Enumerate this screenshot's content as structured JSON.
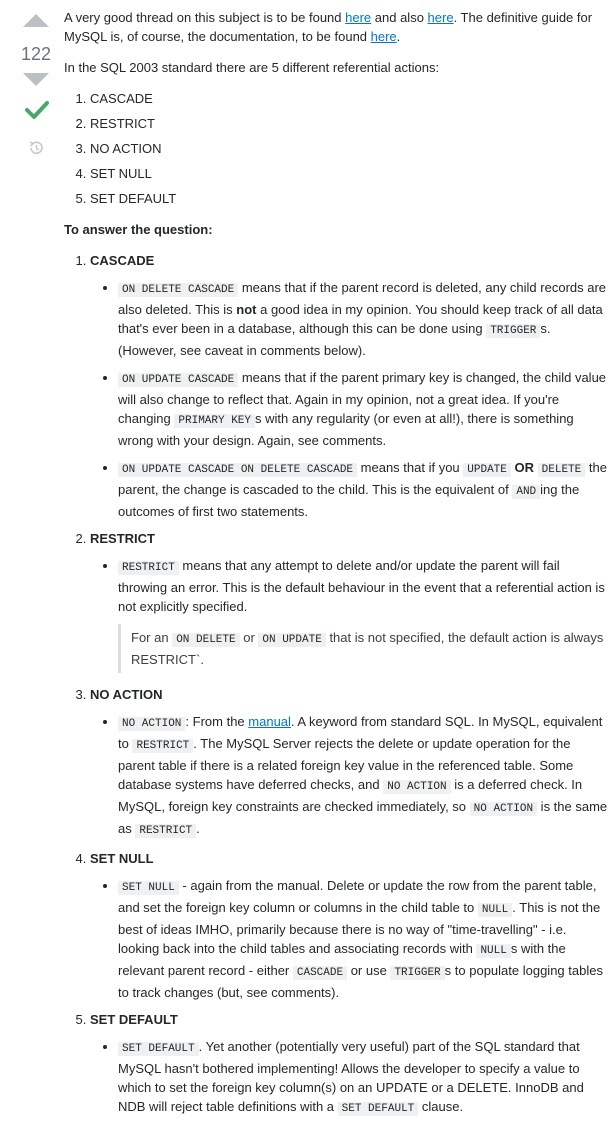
{
  "vote": {
    "count": "122"
  },
  "intro": {
    "part1": "A very good thread on this subject is to be found ",
    "link1": "here",
    "part2": " and also ",
    "link2": "here",
    "part3": ". The definitive guide for MySQL is, of course, the documentation, to be found ",
    "link3": "here",
    "part4": "."
  },
  "standard_text": "In the SQL 2003 standard there are 5 different referential actions:",
  "actions": [
    "CASCADE",
    "RESTRICT",
    "NO ACTION",
    "SET NULL",
    "SET DEFAULT"
  ],
  "answer_heading": "To answer the question:",
  "sections": {
    "cascade": {
      "title": "CASCADE",
      "b1": {
        "code1": "ON DELETE CASCADE",
        "t1": " means that if the parent record is deleted, any child records are also deleted. This is ",
        "bold": "not",
        "t2": " a good idea in my opinion. You should keep track of all data that's ever been in a database, although this can be done using ",
        "code2": "TRIGGER",
        "t3": "s. (However, see caveat in comments below)."
      },
      "b2": {
        "code1": "ON UPDATE CASCADE",
        "t1": " means that if the parent primary key is changed, the child value will also change to reflect that. Again in my opinion, not a great idea. If you're changing ",
        "code2": "PRIMARY KEY",
        "t2": "s with any regularity (or even at all!), there is something wrong with your design. Again, see comments."
      },
      "b3": {
        "code1": "ON UPDATE CASCADE ON DELETE CASCADE",
        "t1": " means that if you ",
        "code2": "UPDATE",
        "bold": "OR",
        "code3": "DELETE",
        "t2": " the parent, the change is cascaded to the child. This is the equivalent of ",
        "code4": "AND",
        "t3": "ing the outcomes of first two statements."
      }
    },
    "restrict": {
      "title": "RESTRICT",
      "b1": {
        "code1": "RESTRICT",
        "t1": " means that any attempt to delete and/or update the parent will fail throwing an error. This is the default behaviour in the event that a referential action is not explicitly specified."
      },
      "quote": {
        "t1": "For an ",
        "code1": "ON DELETE",
        "t2": " or ",
        "code2": "ON UPDATE",
        "t3": " that is not specified, the default action is always RESTRICT`."
      }
    },
    "noaction": {
      "title": "NO ACTION",
      "b1": {
        "code1": "NO ACTION",
        "t1": ": From the ",
        "link": "manual",
        "t2": ". A keyword from standard SQL. In MySQL, equivalent to ",
        "code2": "RESTRICT",
        "t3": ". The MySQL Server rejects the delete or update operation for the parent table if there is a related foreign key value in the referenced table. Some database systems have deferred checks, and ",
        "code3": "NO ACTION",
        "t4": " is a deferred check. In MySQL, foreign key constraints are checked immediately, so ",
        "code4": "NO ACTION",
        "t5": " is the same as ",
        "code5": "RESTRICT",
        "t6": "."
      }
    },
    "setnull": {
      "title": "SET NULL",
      "b1": {
        "code1": "SET NULL",
        "t1": " - again from the manual. Delete or update the row from the parent table, and set the foreign key column or columns in the child table to ",
        "code2": "NULL",
        "t2": ". This is not the best of ideas IMHO, primarily because there is no way of \"time-travelling\" - i.e. looking back into the child tables and associating records with ",
        "code3": "NULL",
        "t3": "s with the relevant parent record - either ",
        "code4": "CASCADE",
        "t4": " or use ",
        "code5": "TRIGGER",
        "t5": "s to populate logging tables to track changes (but, see comments)."
      }
    },
    "setdefault": {
      "title": "SET DEFAULT",
      "b1": {
        "code1": "SET DEFAULT",
        "t1": ". Yet another (potentially very useful) part of the SQL standard that MySQL hasn't bothered implementing! Allows the developer to specify a value to which to set the foreign key column(s) on an UPDATE or a DELETE. InnoDB and NDB will reject table definitions with a ",
        "code2": "SET DEFAULT",
        "t2": " clause."
      }
    }
  },
  "colors": {
    "link": "#0077cc",
    "accepted": "#48a868",
    "vote_arrow": "#bbc0c4",
    "code_bg": "#eff0f1"
  },
  "icons": {
    "upvote": "triangle-up",
    "downvote": "triangle-down",
    "accepted": "checkmark",
    "history": "history-clock"
  }
}
